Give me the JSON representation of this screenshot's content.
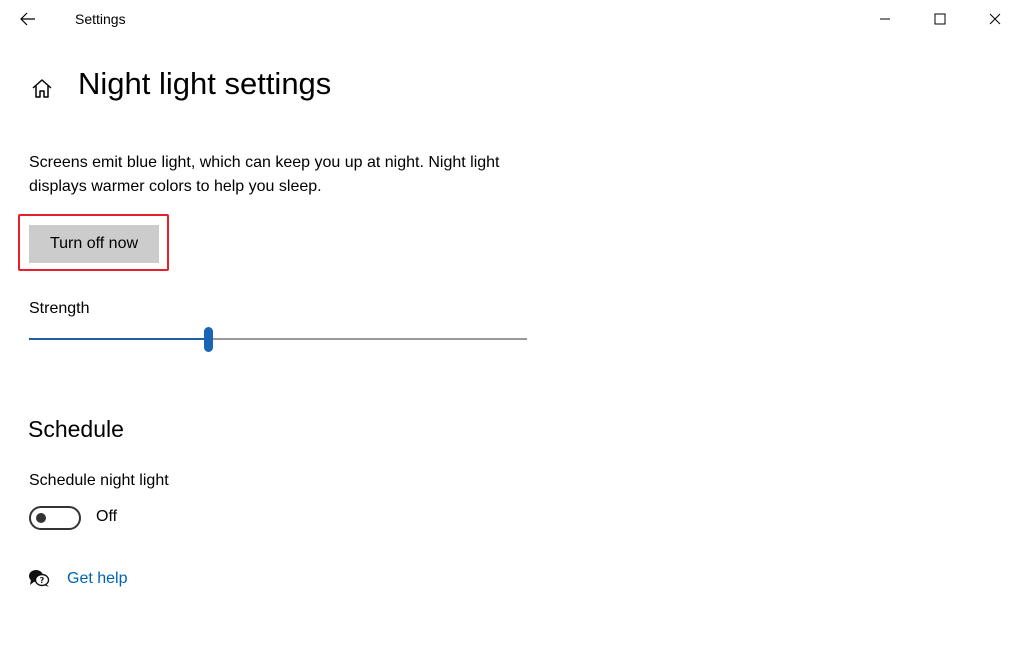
{
  "window": {
    "app_title": "Settings",
    "controls": [
      "minimize-icon",
      "maximize-icon",
      "close-icon"
    ]
  },
  "header": {
    "back_icon": "back-arrow-icon",
    "home_icon": "home-icon",
    "title": "Night light settings"
  },
  "main": {
    "description": "Screens emit blue light, which can keep you up at night. Night light displays warmer colors to help you sleep.",
    "turn_off_button": "Turn off now",
    "highlight_color": "#e3202c",
    "strength": {
      "label": "Strength",
      "value_fraction": 0.36,
      "accent_color": "#1a63b5"
    }
  },
  "schedule": {
    "section_title": "Schedule",
    "label": "Schedule night light",
    "toggle_state": "Off"
  },
  "help": {
    "icon": "help-chat-icon",
    "link_text": "Get help",
    "link_color": "#0063b1"
  }
}
